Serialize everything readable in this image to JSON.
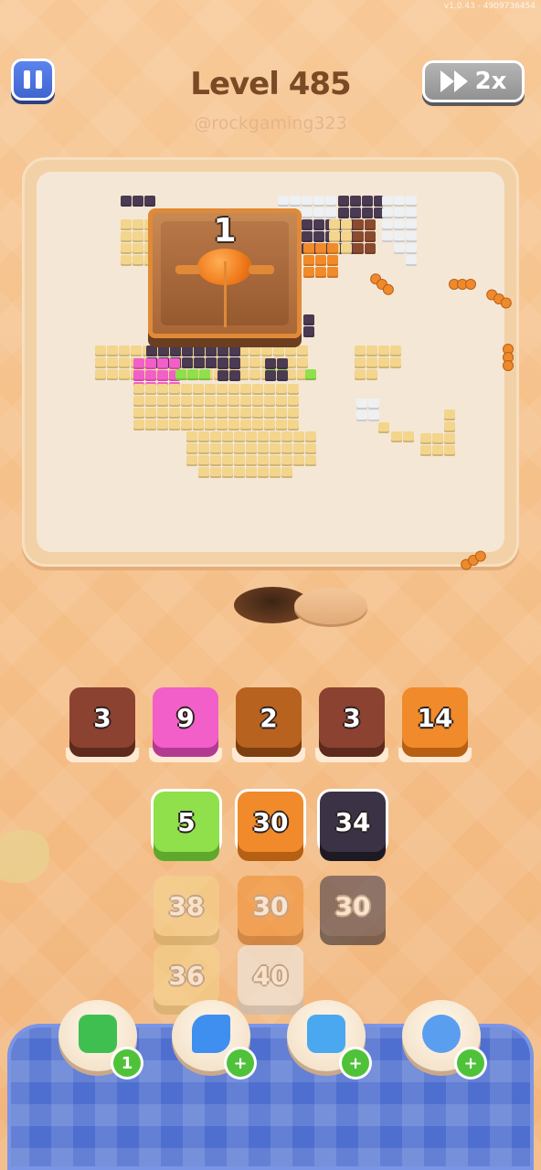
{
  "version": "v1.0.43 - 4909736454",
  "header": {
    "title": "Level 485",
    "subtitle": "@rockgaming323",
    "speed_label": "2x"
  },
  "board": {
    "crate_count": "1",
    "colors": {
      "cream": "#f3d58c",
      "dark": "#4a3a52",
      "orange": "#f08a2a",
      "pink": "#f25fc8",
      "green": "#8fe04a",
      "white": "#eef0f2",
      "brown": "#8a4a2e"
    }
  },
  "queue_tiles": [
    {
      "value": "3",
      "color": "#8b4230",
      "shadow": "#5e2a1c"
    },
    {
      "value": "9",
      "color": "#f25fc8",
      "shadow": "#b33a93"
    },
    {
      "value": "2",
      "color": "#b8621f",
      "shadow": "#7d3f10"
    },
    {
      "value": "3",
      "color": "#8b4230",
      "shadow": "#5e2a1c"
    },
    {
      "value": "14",
      "color": "#f08a2a",
      "shadow": "#b75f12"
    }
  ],
  "grid_tiles": [
    {
      "value": "5",
      "color": "#8fe04a",
      "shadow": "#5ea82b",
      "faded": false
    },
    {
      "value": "30",
      "color": "#f08a2a",
      "shadow": "#b75f12",
      "faded": false
    },
    {
      "value": "34",
      "color": "#3b3345",
      "shadow": "#1e1a24",
      "faded": false
    },
    {
      "value": "38",
      "color": "#f3d58c",
      "shadow": "#c9a85e",
      "faded": true
    },
    {
      "value": "30",
      "color": "#f08a2a",
      "shadow": "#b75f12",
      "faded": true
    },
    {
      "value": "30",
      "color": "#3b3345",
      "shadow": "#1e1a24",
      "faded": true
    },
    {
      "value": "36",
      "color": "#f3d58c",
      "shadow": "#c9a85e",
      "faded": true
    },
    {
      "value": "40",
      "color": "#eef0f2",
      "shadow": "#b8bcc2",
      "faded": true
    }
  ],
  "powerups": [
    {
      "name": "add-slot",
      "badge": "1",
      "icon_color": "#3fbf4f"
    },
    {
      "name": "shuffle",
      "badge": "+",
      "icon_color": "#3f8ff0"
    },
    {
      "name": "magnet",
      "badge": "+",
      "icon_color": "#4aa8f0"
    },
    {
      "name": "bomb",
      "badge": "+",
      "icon_color": "#5a9ef0"
    }
  ]
}
